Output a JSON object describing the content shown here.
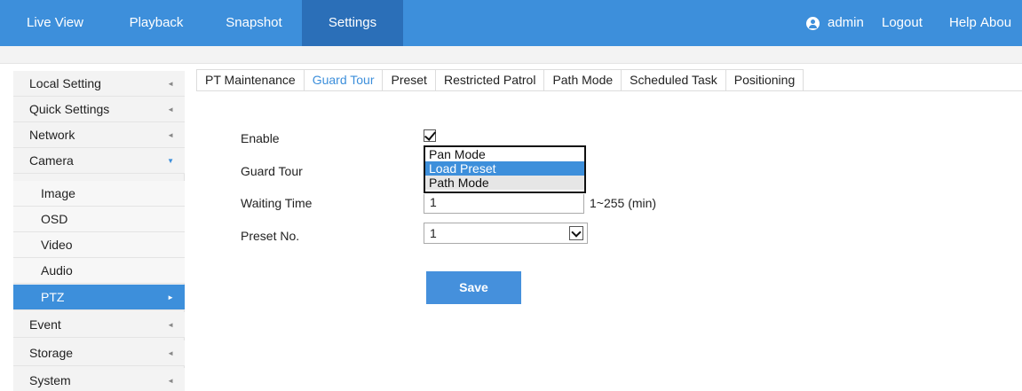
{
  "topnav": {
    "items": [
      {
        "label": "Live View"
      },
      {
        "label": "Playback"
      },
      {
        "label": "Snapshot"
      },
      {
        "label": "Settings",
        "active": true
      }
    ],
    "user": "admin",
    "logout": "Logout",
    "help": "Help",
    "about": "Abou"
  },
  "sidebar": {
    "items": [
      {
        "label": "Local Setting",
        "arrow": "◄"
      },
      {
        "label": "Quick Settings",
        "arrow": "◄"
      },
      {
        "label": "Network",
        "arrow": "◄"
      },
      {
        "label": "Camera",
        "arrow": "▼"
      },
      {
        "label": "Image"
      },
      {
        "label": "OSD"
      },
      {
        "label": "Video"
      },
      {
        "label": "Audio"
      },
      {
        "label": "PTZ",
        "arrow": "►",
        "active": true
      },
      {
        "label": "Event",
        "arrow": "◄"
      },
      {
        "label": "Storage",
        "arrow": "◄"
      },
      {
        "label": "System",
        "arrow": "◄"
      }
    ]
  },
  "tabs": [
    {
      "label": "PT Maintenance"
    },
    {
      "label": "Guard Tour",
      "active": true
    },
    {
      "label": "Preset"
    },
    {
      "label": "Restricted Patrol"
    },
    {
      "label": "Path Mode"
    },
    {
      "label": "Scheduled Task"
    },
    {
      "label": "Positioning"
    }
  ],
  "form": {
    "enable_label": "Enable",
    "enable_checked": true,
    "guard_tour_label": "Guard Tour",
    "guard_tour_options": [
      "Pan Mode",
      "Load Preset",
      "Path Mode"
    ],
    "guard_tour_selected": "Load Preset",
    "waiting_time_label": "Waiting Time",
    "waiting_time_value": "1",
    "waiting_time_range": "1~255  (min)",
    "preset_label": "Preset No.",
    "preset_value": "1",
    "save_label": "Save"
  },
  "colors": {
    "accent": "#3d8fdb",
    "active_nav": "#2b6fb8"
  }
}
